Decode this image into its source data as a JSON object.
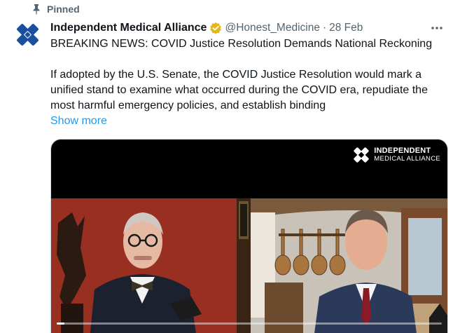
{
  "pinned": {
    "label": "Pinned"
  },
  "tweet": {
    "author_name": "Independent Medical Alliance",
    "handle": "@Honest_Medicine",
    "separator": "·",
    "date": "28 Feb",
    "headline": "BREAKING NEWS: COVID Justice Resolution Demands National Reckoning",
    "body": "If adopted by the U.S. Senate, the COVID Justice Resolution would mark a unified stand to examine what occurred during the COVID era, repudiate the most harmful emergency policies, and establish binding",
    "show_more": "Show more"
  },
  "video": {
    "logo_line1": "INDEPENDENT",
    "logo_line2": "MEDICAL ALLIANCE",
    "progress": 0.02
  },
  "colors": {
    "accent": "#1d9bf0",
    "secondary_text": "#536471",
    "verified_gold": "#e2b719",
    "brand_blue": "#1a4f9c"
  },
  "icons": [
    "pin-icon",
    "avatar-logo",
    "verified-badge-icon",
    "more-options-icon",
    "video-logo-icon"
  ]
}
